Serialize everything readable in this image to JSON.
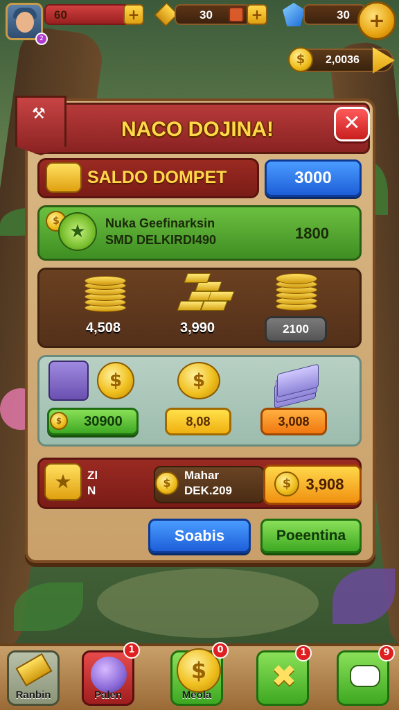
{
  "hud": {
    "hearts": "60",
    "gold_bars": "30",
    "gems": "30",
    "coin_balance": "2,0036",
    "avatar_level": "2"
  },
  "dialog": {
    "title": "NACO DOJINA!",
    "close_label": "✕",
    "saldo": {
      "label": "SALDO DOMPET",
      "button": "3000"
    },
    "offer": {
      "line1": "Nuka Geefinarksin",
      "line2": "SMD DELKIRDI490",
      "value": "1800"
    },
    "packs": [
      {
        "value": "4,508"
      },
      {
        "value": "3,990"
      },
      {
        "button": "2100"
      }
    ],
    "shop": {
      "buttons": [
        "30900",
        "8,08",
        "3,008"
      ]
    },
    "reward": {
      "left_line1": "Zl",
      "left_line2": "N",
      "mid_line1": "Mahar",
      "mid_line2": "DEK.209",
      "button": "3,908"
    },
    "actions": {
      "left": "Soabis",
      "right": "Poeentina"
    }
  },
  "nav": {
    "items": [
      {
        "label": "Ranbin",
        "badge": ""
      },
      {
        "label": "Palen",
        "badge": "1"
      },
      {
        "label": "Meola",
        "badge": "0"
      },
      {
        "label": "",
        "badge": "1"
      },
      {
        "label": "",
        "badge": "9"
      }
    ]
  }
}
